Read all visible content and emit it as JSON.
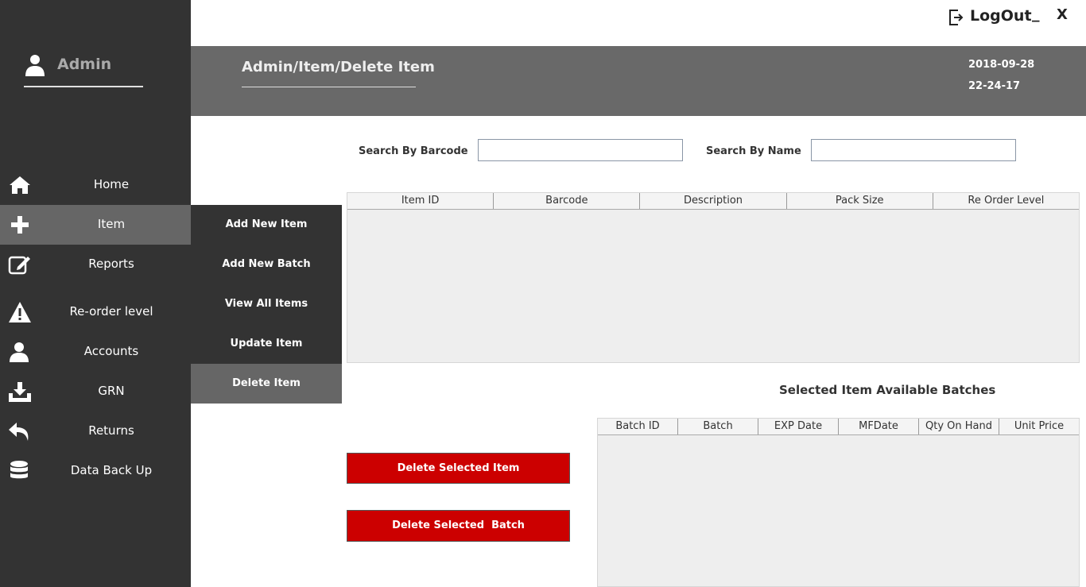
{
  "sidebar": {
    "user": "Admin",
    "items": [
      {
        "label": "Home",
        "icon": "home-icon"
      },
      {
        "label": "Item",
        "icon": "plus-icon"
      },
      {
        "label": "Reports",
        "icon": "edit-icon"
      },
      {
        "label": "Re-order level",
        "icon": "warning-icon"
      },
      {
        "label": "Accounts",
        "icon": "user-icon"
      },
      {
        "label": "GRN",
        "icon": "download-icon"
      },
      {
        "label": "Returns",
        "icon": "return-icon"
      },
      {
        "label": "Data Back Up",
        "icon": "database-icon"
      }
    ],
    "active": "Item"
  },
  "submenu": {
    "items": [
      "Add New Item",
      "Add New Batch",
      "View All Items",
      "Update Item",
      "Delete Item"
    ],
    "active": "Delete Item"
  },
  "topbar": {
    "logout_label": "LogOut",
    "minimize_label": "_",
    "close_label": "X"
  },
  "header": {
    "breadcrumb": "Admin/Item/Delete Item",
    "date": "2018-09-28",
    "time": "22-24-17"
  },
  "search": {
    "barcode_label": "Search By Barcode",
    "barcode_value": "",
    "name_label": "Search By Name",
    "name_value": ""
  },
  "items_table": {
    "columns": [
      "Item ID",
      "Barcode",
      "Description",
      "Pack Size",
      "Re Order Level"
    ],
    "rows": []
  },
  "batches": {
    "title": "Selected Item Available Batches",
    "columns": [
      "Batch ID",
      "Batch",
      "EXP Date",
      "MFDate",
      "Qty On Hand",
      "Unit Price"
    ],
    "rows": []
  },
  "buttons": {
    "delete_item": "Delete Selected Item",
    "delete_batch": "Delete Selected  Batch"
  },
  "colors": {
    "sidebar_bg": "#333333",
    "active_bg": "#666666",
    "header_bg": "#696969",
    "danger": "#cc0000"
  }
}
